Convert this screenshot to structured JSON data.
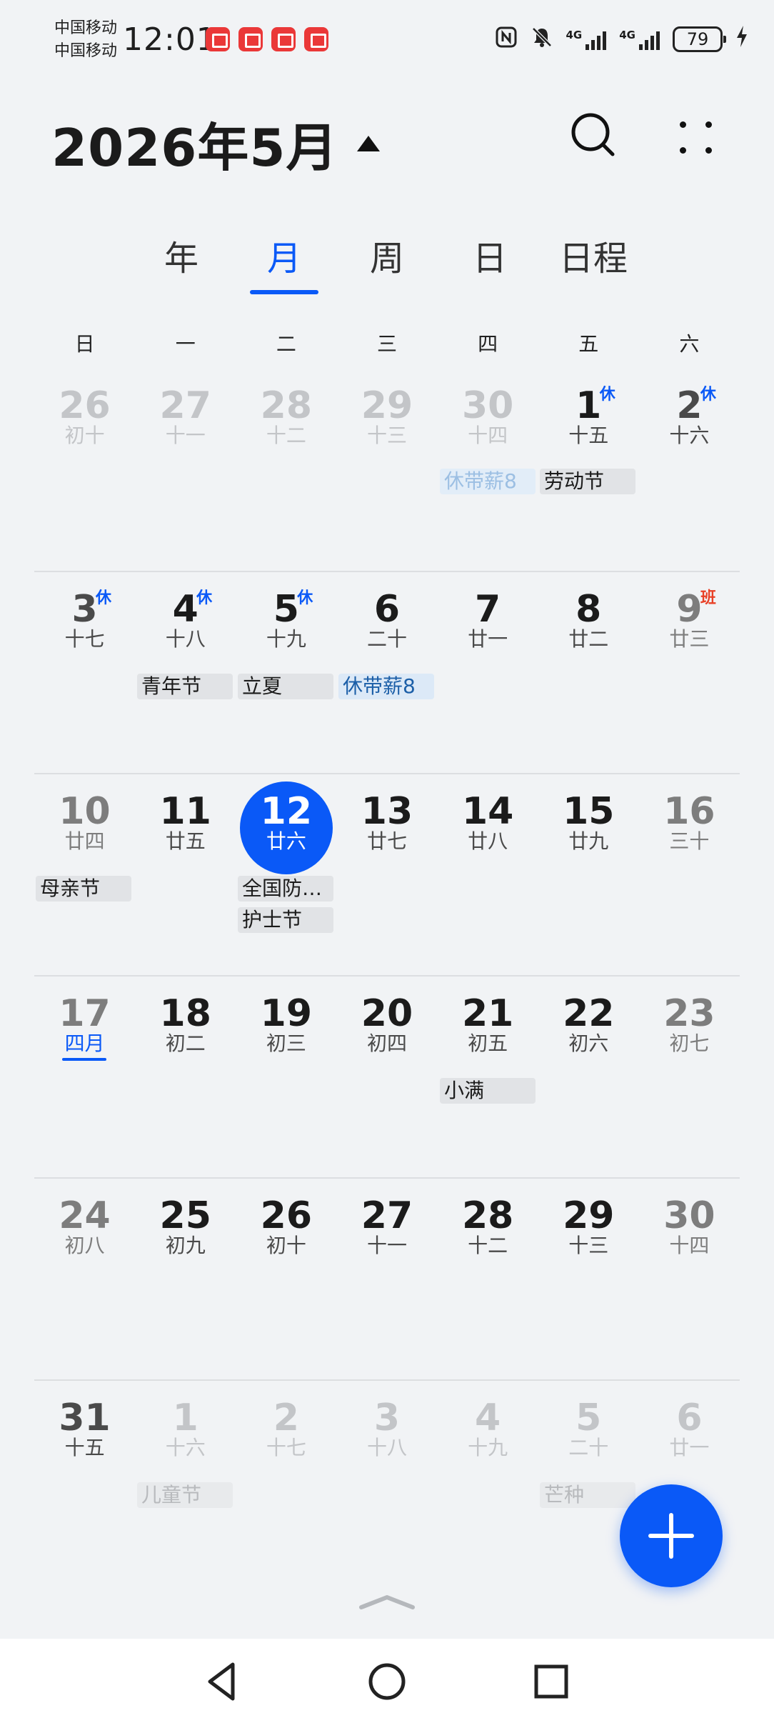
{
  "status_bar": {
    "carrier_1": "中国移动",
    "carrier_2": "中国移动",
    "time": "12:01",
    "network_1": "4G",
    "network_2": "4G",
    "battery": "79"
  },
  "header": {
    "month_title": "2026年5月"
  },
  "tabs": [
    {
      "label": "年"
    },
    {
      "label": "月",
      "active": true
    },
    {
      "label": "周"
    },
    {
      "label": "日"
    },
    {
      "label": "日程"
    }
  ],
  "weekdays": [
    "日",
    "一",
    "二",
    "三",
    "四",
    "五",
    "六"
  ],
  "weeks": [
    [
      {
        "day": "26",
        "lunar": "初十"
      },
      {
        "day": "27",
        "lunar": "十一"
      },
      {
        "day": "28",
        "lunar": "十二"
      },
      {
        "day": "29",
        "lunar": "十三"
      },
      {
        "day": "30",
        "lunar": "十四"
      },
      {
        "day": "1",
        "lunar": "十五",
        "badge": "休"
      },
      {
        "day": "2",
        "lunar": "十六",
        "badge": "休"
      }
    ],
    [
      {
        "day": "3",
        "lunar": "十七",
        "badge": "休"
      },
      {
        "day": "4",
        "lunar": "十八",
        "badge": "休"
      },
      {
        "day": "5",
        "lunar": "十九",
        "badge": "休"
      },
      {
        "day": "6",
        "lunar": "二十"
      },
      {
        "day": "7",
        "lunar": "廿一"
      },
      {
        "day": "8",
        "lunar": "廿二"
      },
      {
        "day": "9",
        "lunar": "廿三",
        "badge": "班"
      }
    ],
    [
      {
        "day": "10",
        "lunar": "廿四"
      },
      {
        "day": "11",
        "lunar": "廿五"
      },
      {
        "day": "12",
        "lunar": "廿六"
      },
      {
        "day": "13",
        "lunar": "廿七"
      },
      {
        "day": "14",
        "lunar": "廿八"
      },
      {
        "day": "15",
        "lunar": "廿九"
      },
      {
        "day": "16",
        "lunar": "三十"
      }
    ],
    [
      {
        "day": "17",
        "lunar": "四月"
      },
      {
        "day": "18",
        "lunar": "初二"
      },
      {
        "day": "19",
        "lunar": "初三"
      },
      {
        "day": "20",
        "lunar": "初四"
      },
      {
        "day": "21",
        "lunar": "初五"
      },
      {
        "day": "22",
        "lunar": "初六"
      },
      {
        "day": "23",
        "lunar": "初七"
      }
    ],
    [
      {
        "day": "24",
        "lunar": "初八"
      },
      {
        "day": "25",
        "lunar": "初九"
      },
      {
        "day": "26",
        "lunar": "初十"
      },
      {
        "day": "27",
        "lunar": "十一"
      },
      {
        "day": "28",
        "lunar": "十二"
      },
      {
        "day": "29",
        "lunar": "十三"
      },
      {
        "day": "30",
        "lunar": "十四"
      }
    ],
    [
      {
        "day": "31",
        "lunar": "十五"
      },
      {
        "day": "1",
        "lunar": "十六"
      },
      {
        "day": "2",
        "lunar": "十七"
      },
      {
        "day": "3",
        "lunar": "十八"
      },
      {
        "day": "4",
        "lunar": "十九"
      },
      {
        "day": "5",
        "lunar": "二十"
      },
      {
        "day": "6",
        "lunar": "廿一"
      }
    ]
  ],
  "events": {
    "w1_salary": "休带薪8",
    "w1_labor_day": "劳动节",
    "w2_youth_day": "青年节",
    "w2_lixia": "立夏",
    "w2_salary": "休带薪8",
    "w3_mothers_day": "母亲节",
    "w3_national": "全国防…",
    "w3_nurses_day": "护士节",
    "w4_xiaoman": "小满",
    "w6_childrens_day": "儿童节",
    "w6_mangzhong": "芒种"
  },
  "colors": {
    "accent": "#0a59f7",
    "work_badge": "#e84026",
    "background": "#f1f3f5"
  },
  "icons": [
    "search-icon",
    "more-icon",
    "add-icon",
    "back-icon",
    "home-icon",
    "recents-icon",
    "nfc-icon",
    "mute-icon",
    "charging-icon"
  ]
}
